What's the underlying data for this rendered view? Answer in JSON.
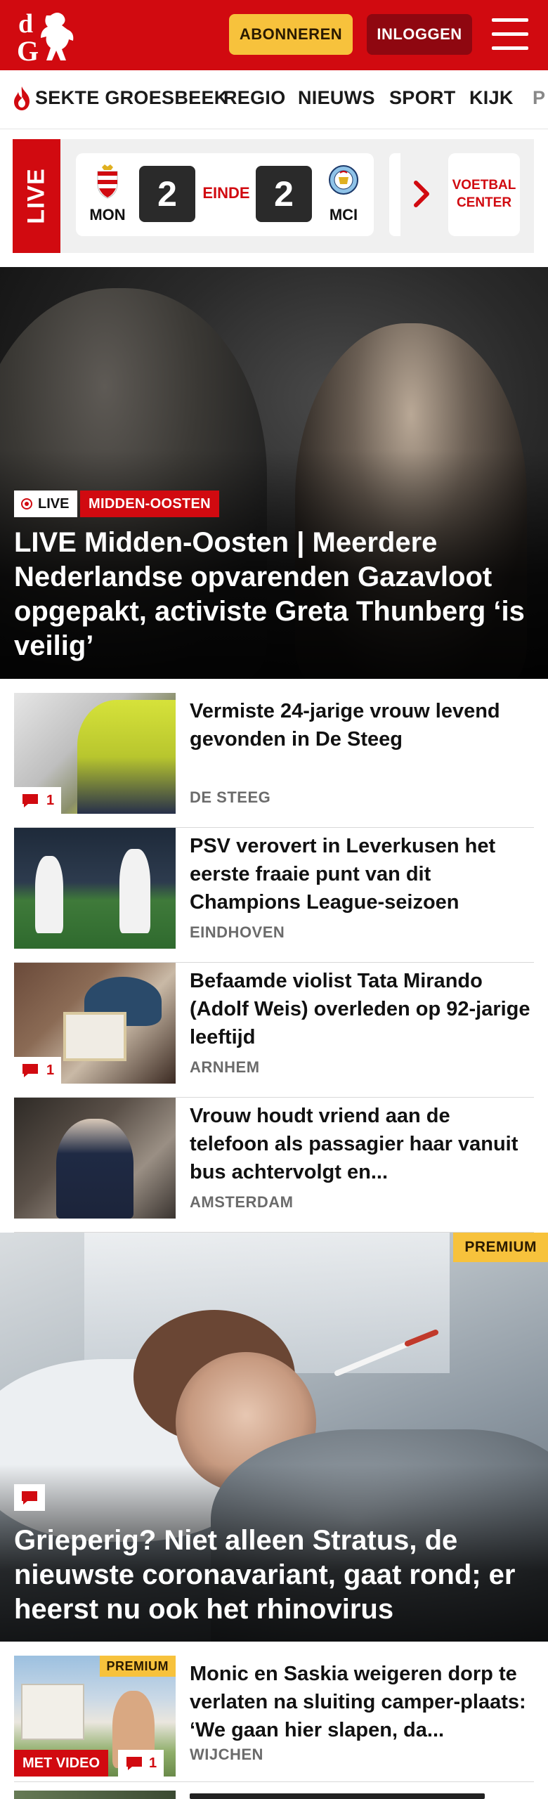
{
  "header": {
    "logo_text": "dG",
    "subscribe_label": "ABONNEREN",
    "login_label": "INLOGGEN",
    "menu_icon": "hamburger-icon",
    "brand_color": "#d10a10"
  },
  "nav": {
    "items": [
      "SEKTE GROESBEEK",
      "REGIO",
      "NIEUWS",
      "SPORT",
      "KIJK",
      "P"
    ],
    "trending_icon": "flame-icon"
  },
  "live": {
    "label": "LIVE",
    "match": {
      "home_abbr": "MON",
      "home_score": "2",
      "status": "EINDE",
      "away_score": "2",
      "away_abbr": "MCI"
    },
    "next_icon": "chevron-right-icon",
    "football_center": "VOETBAL CENTER"
  },
  "hero": {
    "live_label": "LIVE",
    "category": "MIDDEN-OOSTEN",
    "title": "LIVE Midden-Oosten | Meerdere Nederlandse opvarenden Gazavloot opgepakt, activiste Greta Thunberg ‘is veilig’"
  },
  "articles": [
    {
      "title": "Vermiste 24-jarige vrouw levend gevonden in De Steeg",
      "location": "DE STEEG",
      "comments": "1"
    },
    {
      "title": "PSV verovert in Leverkusen het eerste fraaie punt van dit Champions League-seizoen",
      "location": "EINDHOVEN",
      "comments": ""
    },
    {
      "title": "Befaamde violist Tata Mirando (Adolf Weis) overleden op 92-jarige leeftijd",
      "location": "ARNHEM",
      "comments": "1"
    },
    {
      "title": "Vrouw houdt vriend aan de telefoon als passagier haar vanuit bus achtervolgt en...",
      "location": "AMSTERDAM",
      "comments": ""
    }
  ],
  "premium_feature": {
    "badge": "PREMIUM",
    "title": "Grieperig? Niet alleen Stratus, de nieuwste coronavariant, gaat rond; er heerst nu ook het rhinovirus"
  },
  "premium_article": {
    "badge": "PREMIUM",
    "title": "Monic en Saskia weigeren dorp te verlaten na sluiting camper-plaats: ‘We gaan hier slapen, da...",
    "location": "WIJCHEN",
    "video_label": "MET VIDEO",
    "comments": "1"
  }
}
